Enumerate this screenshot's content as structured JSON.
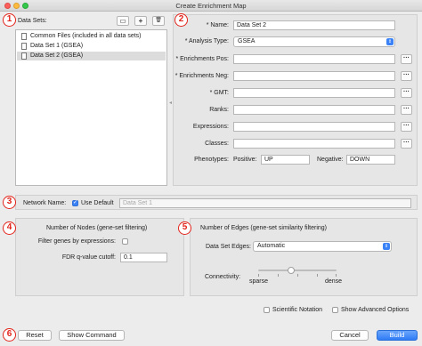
{
  "window": {
    "title": "Create Enrichment Map"
  },
  "markers": [
    "1",
    "2",
    "3",
    "4",
    "5",
    "6"
  ],
  "data_sets": {
    "label": "Data Sets:",
    "toolbar": {
      "open_folder": "▭",
      "add": "+",
      "delete": "🗑"
    },
    "items": [
      {
        "label": "Common Files (included in all data sets)",
        "selected": false
      },
      {
        "label": "Data Set 1  (GSEA)",
        "selected": false
      },
      {
        "label": "Data Set 2  (GSEA)",
        "selected": true
      }
    ]
  },
  "form": {
    "name_label": "* Name:",
    "name_value": "Data Set 2",
    "analysis_type_label": "* Analysis Type:",
    "analysis_type_value": "GSEA",
    "enrichments_pos_label": "* Enrichments Pos:",
    "enrichments_neg_label": "* Enrichments Neg:",
    "gmt_label": "* GMT:",
    "ranks_label": "Ranks:",
    "expressions_label": "Expressions:",
    "classes_label": "Classes:",
    "phenotypes_label": "Phenotypes:",
    "positive_label": "Positive:",
    "positive_value": "UP",
    "negative_label": "Negative:",
    "negative_value": "DOWN",
    "browse_label": "···"
  },
  "network": {
    "label": "Network Name:",
    "use_default_label": "Use Default",
    "use_default_checked": true,
    "name_placeholder": "Data Set 1"
  },
  "nodes": {
    "title": "Number of Nodes (gene-set filtering)",
    "filter_label": "Filter genes by expressions:",
    "fdr_label": "FDR q-value cutoff:",
    "fdr_value": "0.1"
  },
  "edges": {
    "title": "Number of Edges (gene-set similarity filtering)",
    "data_set_edges_label": "Data Set Edges:",
    "data_set_edges_value": "Automatic",
    "connectivity_label": "Connectivity:",
    "sparse_label": "sparse",
    "dense_label": "dense",
    "connectivity_level": 0.42
  },
  "options": {
    "scientific_notation_label": "Scientific Notation",
    "show_advanced_label": "Show Advanced Options"
  },
  "footer": {
    "reset_label": "Reset",
    "show_command_label": "Show Command",
    "cancel_label": "Cancel",
    "build_label": "Build"
  }
}
